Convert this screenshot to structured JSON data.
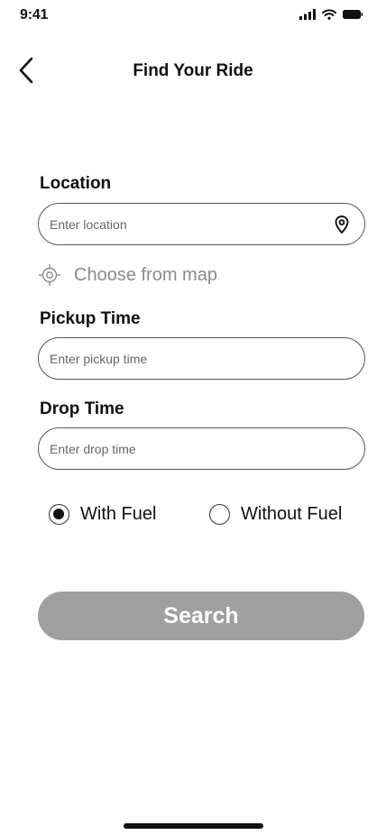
{
  "status_bar": {
    "time": "9:41"
  },
  "header": {
    "title": "Find Your Ride",
    "back_icon": "chevron-left-icon"
  },
  "form": {
    "location": {
      "label": "Location",
      "placeholder": "Enter location",
      "value": "",
      "icon": "location-pin-icon"
    },
    "choose_map": {
      "label": "Choose from map",
      "icon": "crosshair-icon"
    },
    "pickup": {
      "label": "Pickup Time",
      "placeholder": "Enter pickup time",
      "value": ""
    },
    "drop": {
      "label": "Drop Time",
      "placeholder": "Enter drop time",
      "value": ""
    },
    "fuel_options": [
      {
        "label": "With Fuel",
        "selected": true
      },
      {
        "label": "Without Fuel",
        "selected": false
      }
    ]
  },
  "search_button": {
    "label": "Search",
    "color": "#9f9f9f"
  }
}
